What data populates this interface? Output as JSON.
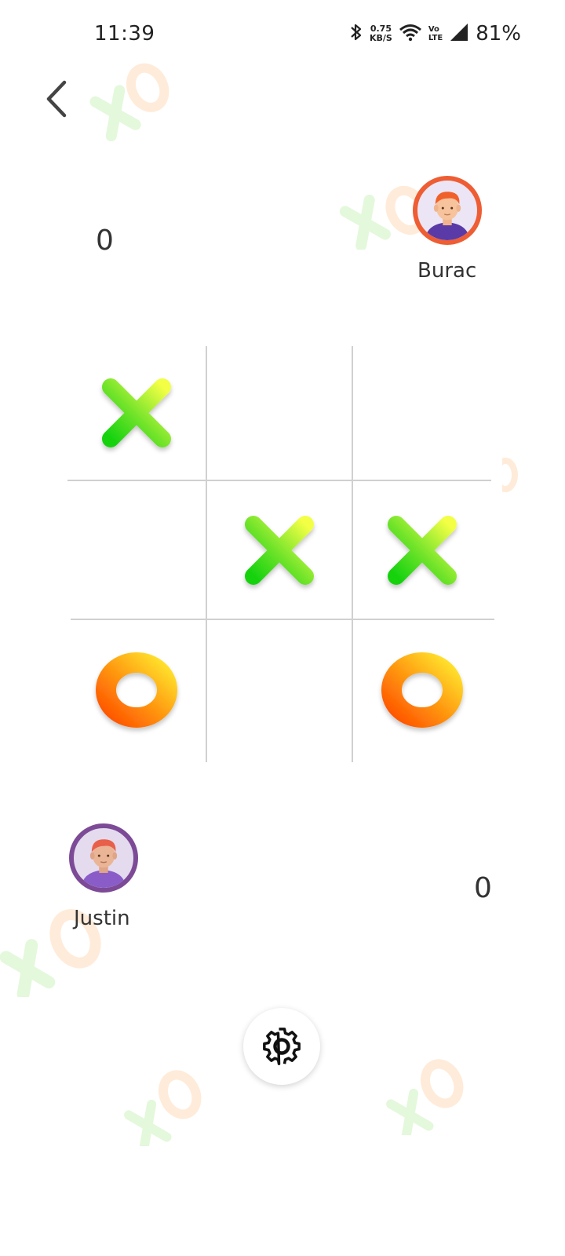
{
  "status_bar": {
    "time": "11:39",
    "net_speed_value": "0.75",
    "net_speed_unit": "KB/S",
    "volte_top": "Vo",
    "volte_bottom": "LTE",
    "battery": "81%"
  },
  "players": {
    "top": {
      "name": "Burac",
      "score": "0",
      "mark": "X"
    },
    "bottom": {
      "name": "Justin",
      "score": "0",
      "mark": "O"
    }
  },
  "board": {
    "cells": [
      "X",
      "",
      "",
      "",
      "X",
      "X",
      "O",
      "",
      "O"
    ]
  },
  "icons": {
    "back": "chevron-left-icon",
    "settings": "gear-icon"
  },
  "colors": {
    "x_gradient_start": "#e6ff3a",
    "x_gradient_end": "#1ed81a",
    "o_gradient_start": "#ffe02a",
    "o_gradient_end": "#ff5a00",
    "top_avatar_ring": "#ee5d33",
    "bottom_avatar_ring": "#7c4a96"
  }
}
